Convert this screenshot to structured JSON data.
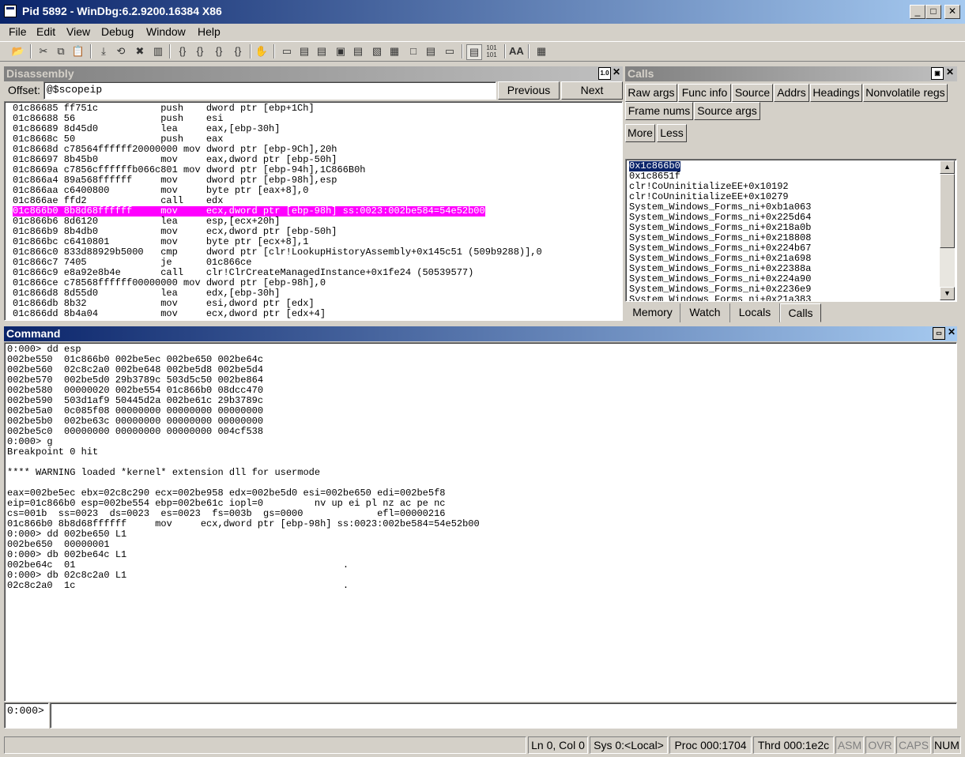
{
  "window": {
    "title": "Pid 5892 - WinDbg:6.2.9200.16384 X86",
    "minimize": "_",
    "maximize": "□",
    "close": "✕"
  },
  "menu": [
    "File",
    "Edit",
    "View",
    "Debug",
    "Window",
    "Help"
  ],
  "toolbar": {
    "icons": [
      "open-icon",
      "cut-icon",
      "copy-icon",
      "paste-icon",
      "go-icon",
      "restart-icon",
      "stop-debugging-icon",
      "break-icon",
      "step-into-icon",
      "step-over-icon",
      "step-out-icon",
      "run-to-cursor-icon",
      "hand-icon",
      "command-window-icon",
      "watch-window-icon",
      "locals-window-icon",
      "registers-window-icon",
      "memory-window-icon",
      "call-stack-window-icon",
      "disassembly-window-icon",
      "scratch-pad-icon",
      "source-mode-icon",
      "hex-mode-icon",
      "font-icon",
      "options-icon"
    ],
    "font_label": "AA",
    "hex_label": "101"
  },
  "disassembly": {
    "title": "Disassembly",
    "offset_label": "Offset:",
    "offset_value": "@$scopeip",
    "previous": "Previous",
    "next": "Next",
    "lines": [
      "01c86685 ff751c           push    dword ptr [ebp+1Ch]",
      "01c86688 56               push    esi",
      "01c86689 8d45d0           lea     eax,[ebp-30h]",
      "01c8668c 50               push    eax",
      "01c8668d c78564ffffff20000000 mov dword ptr [ebp-9Ch],20h",
      "01c86697 8b45b0           mov     eax,dword ptr [ebp-50h]",
      "01c8669a c7856cffffffb066c801 mov dword ptr [ebp-94h],1C866B0h",
      "01c866a4 89a568ffffff     mov     dword ptr [ebp-98h],esp",
      "01c866aa c6400800         mov     byte ptr [eax+8],0",
      "01c866ae ffd2             call    edx",
      "01c866b0 8b8d68ffffff     mov     ecx,dword ptr [ebp-98h] ss:0023:002be584=54e52b00",
      "01c866b6 8d6120           lea     esp,[ecx+20h]",
      "01c866b9 8b4db0           mov     ecx,dword ptr [ebp-50h]",
      "01c866bc c6410801         mov     byte ptr [ecx+8],1",
      "01c866c0 833d88929b5000   cmp     dword ptr [clr!LookupHistoryAssembly+0x145c51 (509b9288)],0",
      "01c866c7 7405             je      01c866ce",
      "01c866c9 e8a92e8b4e       call    clr!ClrCreateManagedInstance+0x1fe24 (50539577)",
      "01c866ce c78568ffffff00000000 mov dword ptr [ebp-98h],0",
      "01c866d8 8d55d0           lea     edx,[ebp-30h]",
      "01c866db 8b32             mov     esi,dword ptr [edx]",
      "01c866dd 8b4a04           mov     ecx,dword ptr [edx+4]"
    ],
    "highlight_index": 10
  },
  "calls": {
    "title": "Calls",
    "buttons_row1": [
      "Raw args",
      "Func info",
      "Source",
      "Addrs",
      "Headings",
      "Nonvolatile regs"
    ],
    "buttons_row2": [
      "Frame nums",
      "Source args"
    ],
    "buttons_row3": [
      "More",
      "Less"
    ],
    "frames": [
      "0x1c866b0",
      "0x1c8651f",
      "clr!CoUninitializeEE+0x10192",
      "clr!CoUninitializeEE+0x10279",
      "System_Windows_Forms_ni+0xb1a063",
      "System_Windows_Forms_ni+0x225d64",
      "System_Windows_Forms_ni+0x218a0b",
      "System_Windows_Forms_ni+0x218808",
      "System_Windows_Forms_ni+0x224b67",
      "System_Windows_Forms_ni+0x21a698",
      "System_Windows_Forms_ni+0x22388a",
      "System_Windows_Forms_ni+0x224a90",
      "System_Windows_Forms_ni+0x2236e9",
      "System_Windows_Forms_ni+0x21a383"
    ],
    "selected_index": 0,
    "tabs": [
      "Memory",
      "Watch",
      "Locals",
      "Calls"
    ],
    "selected_tab": 3
  },
  "command": {
    "title": "Command",
    "output": [
      "0:000> dd esp",
      "002be550  01c866b0 002be5ec 002be650 002be64c",
      "002be560  02c8c2a0 002be648 002be5d8 002be5d4",
      "002be570  002be5d0 29b3789c 503d5c50 002be864",
      "002be580  00000020 002be554 01c866b0 08dcc470",
      "002be590  503d1af9 50445d2a 002be61c 29b3789c",
      "002be5a0  0c085f08 00000000 00000000 00000000",
      "002be5b0  002be63c 00000000 00000000 00000000",
      "002be5c0  00000000 00000000 00000000 004cf538",
      "0:000> g",
      "Breakpoint 0 hit",
      "",
      "**** WARNING loaded *kernel* extension dll for usermode",
      "",
      "eax=002be5ec ebx=02c8c290 ecx=002be958 edx=002be5d0 esi=002be650 edi=002be5f8",
      "eip=01c866b0 esp=002be554 ebp=002be61c iopl=0         nv up ei pl nz ac pe nc",
      "cs=001b  ss=0023  ds=0023  es=0023  fs=003b  gs=0000             efl=00000216",
      "01c866b0 8b8d68ffffff     mov     ecx,dword ptr [ebp-98h] ss:0023:002be584=54e52b00",
      "0:000> dd 002be650 L1",
      "002be650  00000001",
      "0:000> db 002be64c L1",
      "002be64c  01                                               .",
      "0:000> db 02c8c2a0 L1",
      "02c8c2a0  1c                                               ."
    ],
    "prompt": "0:000>",
    "input_value": ""
  },
  "statusbar": {
    "position": "Ln 0, Col 0",
    "sys": "Sys 0:<Local>",
    "proc": "Proc 000:1704",
    "thrd": "Thrd 000:1e2c",
    "asm": "ASM",
    "ovr": "OVR",
    "caps": "CAPS",
    "num": "NUM"
  }
}
